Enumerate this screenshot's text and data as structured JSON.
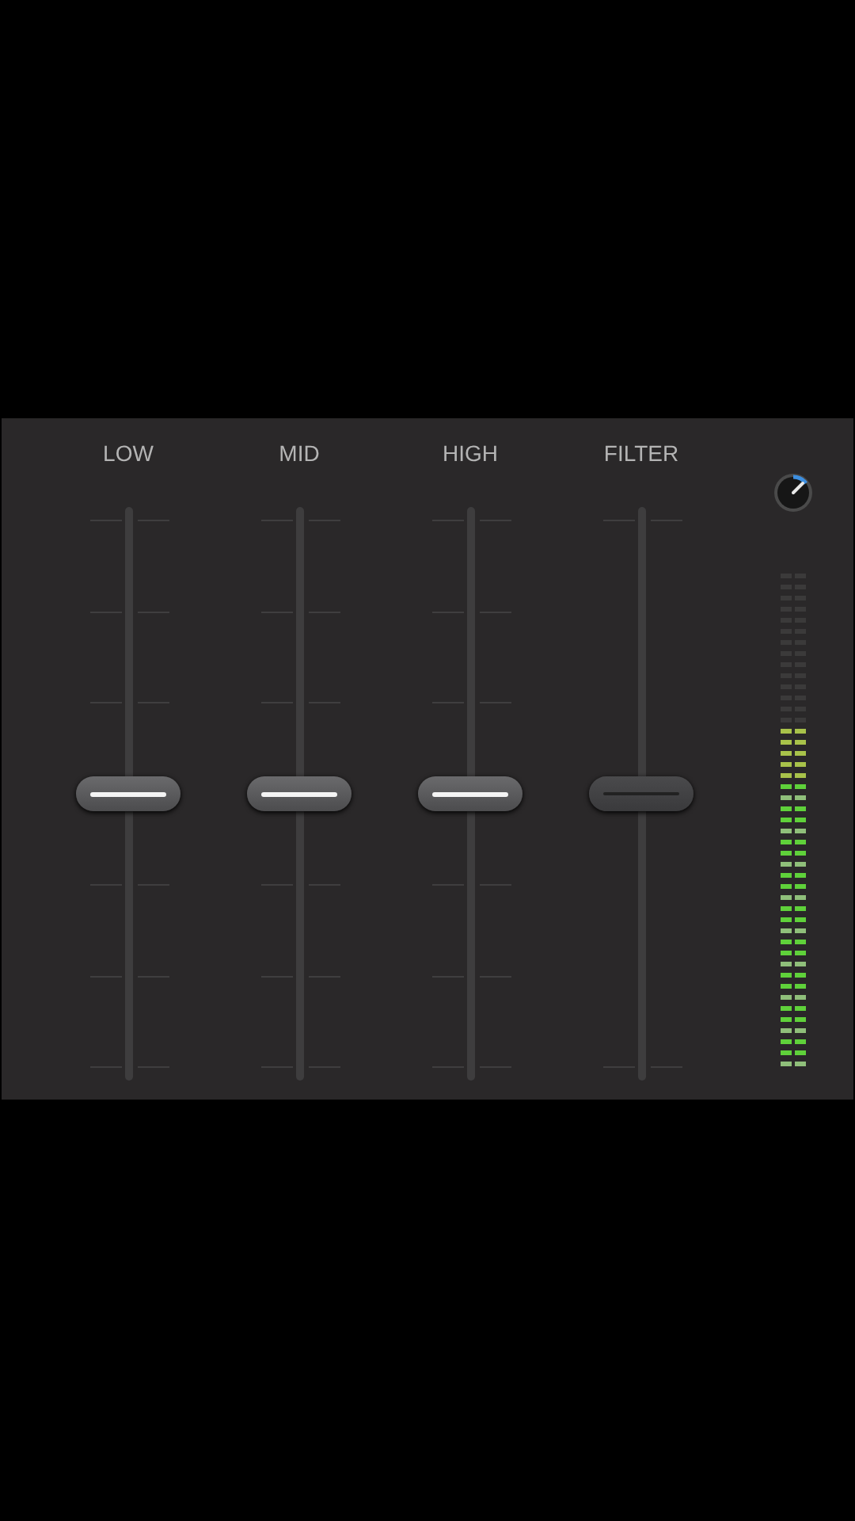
{
  "faders": [
    {
      "label": "LOW",
      "kind": "eq",
      "level": 0.5,
      "disabled": false
    },
    {
      "label": "MID",
      "kind": "eq",
      "level": 0.5,
      "disabled": false
    },
    {
      "label": "HIGH",
      "kind": "eq",
      "level": 0.5,
      "disabled": false
    },
    {
      "label": "FILTER",
      "kind": "filter",
      "level": 0.5,
      "disabled": true
    }
  ]
}
